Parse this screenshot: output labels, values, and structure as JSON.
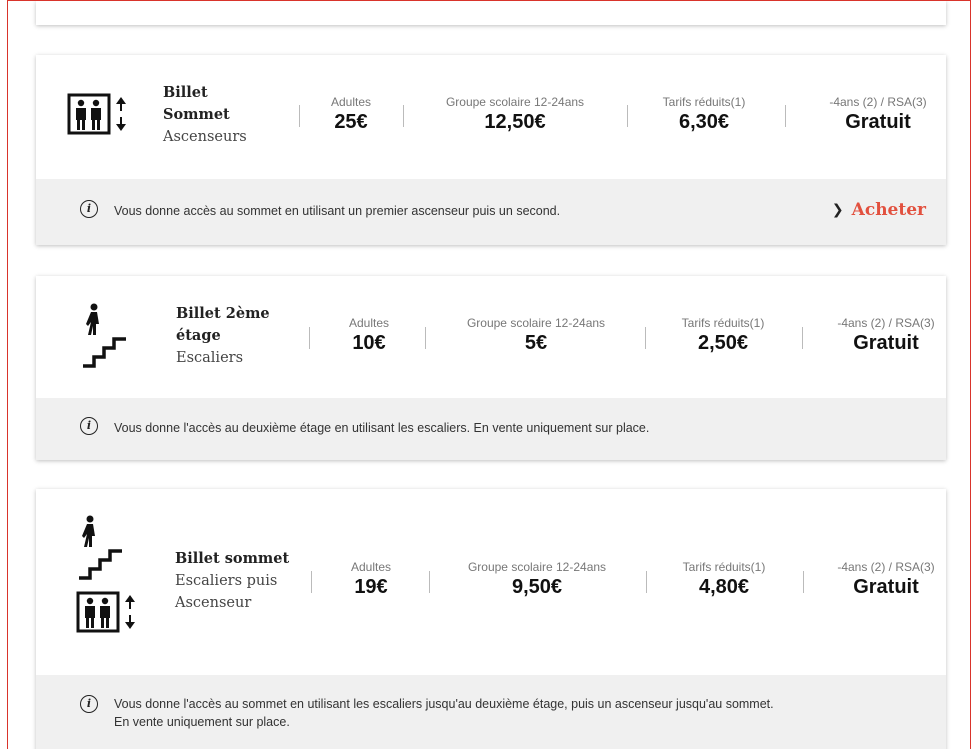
{
  "cards": [
    {
      "name_lines": [
        "Billet",
        "Sommet"
      ],
      "sub_lines": [
        "Ascenseurs"
      ],
      "prices": [
        {
          "label": "Adultes",
          "value": "25€"
        },
        {
          "label": "Groupe scolaire 12-24ans",
          "value": "12,50€"
        },
        {
          "label": "Tarifs réduits(1)",
          "value": "6,30€"
        },
        {
          "label": "-4ans (2) / RSA(3)",
          "value": "Gratuit"
        }
      ],
      "info": "Vous donne accès au sommet en utilisant un premier ascenseur puis un second.",
      "buy_label": "Acheter",
      "icons": [
        "elevator-icon"
      ]
    },
    {
      "name_lines": [
        "Billet 2ème",
        "étage"
      ],
      "sub_lines": [
        "Escaliers"
      ],
      "prices": [
        {
          "label": "Adultes",
          "value": "10€"
        },
        {
          "label": "Groupe scolaire 12-24ans",
          "value": "5€"
        },
        {
          "label": "Tarifs réduits(1)",
          "value": "2,50€"
        },
        {
          "label": "-4ans (2) / RSA(3)",
          "value": "Gratuit"
        }
      ],
      "info": "Vous donne l'accès au deuxième étage en utilisant les escaliers. En vente uniquement sur place.",
      "icons": [
        "stairs-icon"
      ]
    },
    {
      "name_lines": [
        "Billet sommet"
      ],
      "sub_lines": [
        "Escaliers puis",
        "Ascenseur"
      ],
      "prices": [
        {
          "label": "Adultes",
          "value": "19€"
        },
        {
          "label": "Groupe scolaire 12-24ans",
          "value": "9,50€"
        },
        {
          "label": "Tarifs réduits(1)",
          "value": "4,80€"
        },
        {
          "label": "-4ans (2) / RSA(3)",
          "value": "Gratuit"
        }
      ],
      "info_lines": [
        "Vous donne l'accès au sommet en utilisant les escaliers jusqu'au deuxième étage, puis un ascenseur jusqu'au sommet.",
        "En vente uniquement sur place."
      ],
      "icons": [
        "stairs-icon",
        "elevator-icon"
      ]
    }
  ],
  "colors": {
    "accent": "#e2513f",
    "frame": "#d9342b",
    "info_bg": "#f0f0f0"
  }
}
